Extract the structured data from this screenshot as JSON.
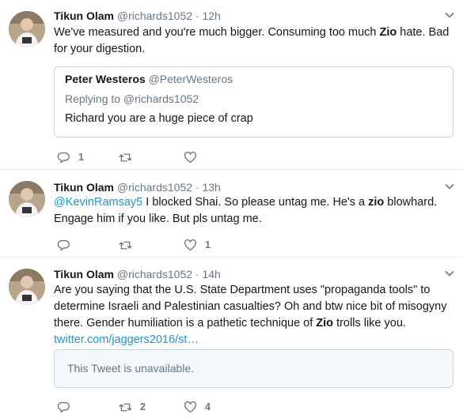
{
  "tweets": [
    {
      "name": "Tikun Olam",
      "handle": "@richards1052",
      "sep": "·",
      "time": "12h",
      "text": {
        "t1": "We've measured and you're much bigger.  Consuming too much ",
        "kw": "Zio",
        "t2": " hate. Bad for your digestion."
      },
      "quote": {
        "name": "Peter Westeros",
        "handle": "@PeterWesteros",
        "replying_to": "Replying to @richards1052",
        "text": "Richard you are a huge piece of crap"
      },
      "reply_count": "1",
      "retweet_count": "",
      "like_count": ""
    },
    {
      "name": "Tikun Olam",
      "handle": "@richards1052",
      "sep": "·",
      "time": "13h",
      "text": {
        "mention": "@KevinRamsay5",
        "t1": " I blocked Shai. So please untag me. He's a ",
        "kw": "zio",
        "t2": " blowhard. Engage him if you like. But pls untag me."
      },
      "reply_count": "",
      "retweet_count": "",
      "like_count": "1"
    },
    {
      "name": "Tikun Olam",
      "handle": "@richards1052",
      "sep": "·",
      "time": "14h",
      "text": {
        "t1": "Are you saying that the U.S. State Department uses \"propaganda tools\" to determine Israeli and Palestinian casualties? Oh and btw nice bit of misogyny there. Gender humiliation is a pathetic technique of ",
        "kw": "Zio",
        "t2": " trolls like you.",
        "link": "twitter.com/jaggers2016/st…"
      },
      "unavailable": "This Tweet is unavailable.",
      "reply_count": "",
      "retweet_count": "2",
      "like_count": "4"
    }
  ],
  "icons": {
    "reply": "reply-icon",
    "retweet": "retweet-icon",
    "like": "heart-icon",
    "caret": "chevron-down-icon"
  }
}
